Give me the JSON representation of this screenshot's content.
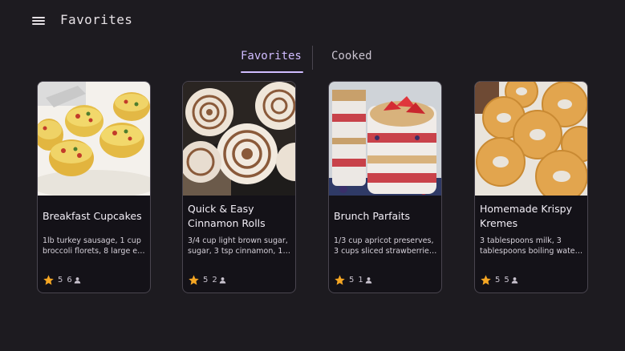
{
  "app": {
    "title": "Favorites",
    "menu_icon": "hamburger-menu-icon"
  },
  "tabs": [
    {
      "label": "Favorites",
      "selected": true
    },
    {
      "label": "Cooked",
      "selected": false
    }
  ],
  "colors": {
    "background": "#1d1b20",
    "accent": "#d0bcff",
    "card_surface": "#141218",
    "card_border": "#49454f",
    "star": "#f5a623"
  },
  "recipes": [
    {
      "title": "Breakfast Cupcakes",
      "desc_line1": "1lb turkey sausage, 1 cup",
      "desc_line2": "broccoli florets, 8 large egg...",
      "rating": "5",
      "count": "6",
      "image": "egg muffins"
    },
    {
      "title": "Quick & Easy Cinnamon Rolls",
      "desc_line1": "3/4 cup light brown sugar,",
      "desc_line2": "sugar, 3 tsp cinnamon, 1/2 ...",
      "rating": "5",
      "count": "2",
      "image": "cinnamon rolls"
    },
    {
      "title": "Brunch Parfaits",
      "desc_line1": "1/3 cup apricot preserves,",
      "desc_line2": "3 cups sliced strawberries, ...",
      "rating": "5",
      "count": "1",
      "image": "yogurt parfaits"
    },
    {
      "title": "Homemade Krispy Kremes",
      "desc_line1": "3 tablespoons milk, 3",
      "desc_line2": "tablespoons boiling water, ...",
      "rating": "5",
      "count": "5",
      "image": "glazed donuts"
    }
  ]
}
